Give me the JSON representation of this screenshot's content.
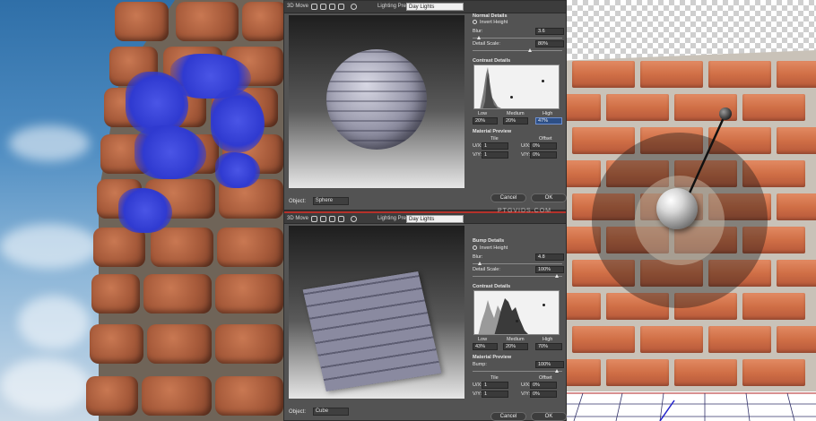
{
  "dialogs": {
    "normal": {
      "toolbar": {
        "move_label": "3D Move",
        "preset_label": "Lighting Preset:",
        "preset_value": "Day Lights"
      },
      "details_title": "Normal Details",
      "invert_label": "Invert Height",
      "blur_label": "Blur:",
      "blur_value": "3.6",
      "detail_scale_label": "Detail Scale:",
      "detail_scale_value": "80%",
      "contrast_title": "Contrast Details",
      "low_label": "Low",
      "medium_label": "Medium",
      "high_label": "High",
      "low_value": "20%",
      "medium_value": "20%",
      "high_value": "47%",
      "material_title": "Material Preview",
      "tile_label": "Tile",
      "offset_label": "Offset",
      "u_tile_label": "U/X:",
      "u_tile_value": "1",
      "v_tile_label": "V/Y:",
      "v_tile_value": "1",
      "u_offset_label": "U/X:",
      "u_offset_value": "0%",
      "v_offset_label": "V/Y:",
      "v_offset_value": "0%",
      "object_label": "Object:",
      "object_value": "Sphere",
      "cancel_label": "Cancel",
      "ok_label": "OK"
    },
    "bump": {
      "toolbar": {
        "move_label": "3D Move",
        "preset_label": "Lighting Preset:",
        "preset_value": "Day Lights"
      },
      "details_title": "Bump Details",
      "invert_label": "Invert Height",
      "blur_label": "Blur:",
      "blur_value": "4.8",
      "detail_scale_label": "Detail Scale:",
      "detail_scale_value": "100%",
      "contrast_title": "Contrast Details",
      "low_label": "Low",
      "medium_label": "Medium",
      "high_label": "High",
      "low_value": "43%",
      "medium_value": "20%",
      "high_value": "70%",
      "material_title": "Material Preview",
      "bump_label": "Bump:",
      "bump_value": "100%",
      "tile_label": "Tile",
      "offset_label": "Offset",
      "u_tile_label": "U/X:",
      "u_tile_value": "1",
      "v_tile_label": "V/Y:",
      "v_tile_value": "1",
      "u_offset_label": "U/X:",
      "u_offset_value": "0%",
      "v_offset_label": "V/Y:",
      "v_offset_value": "0%",
      "object_label": "Object:",
      "object_value": "Cube",
      "cancel_label": "Cancel",
      "ok_label": "OK"
    }
  },
  "watermark": "PTGVIDS.COM",
  "colors": {
    "dialog_bg": "#535353",
    "active_field": "#2d4f86",
    "brick": "#d06f46",
    "graffiti": "#3440d8",
    "sky": "#4f8dc2"
  }
}
